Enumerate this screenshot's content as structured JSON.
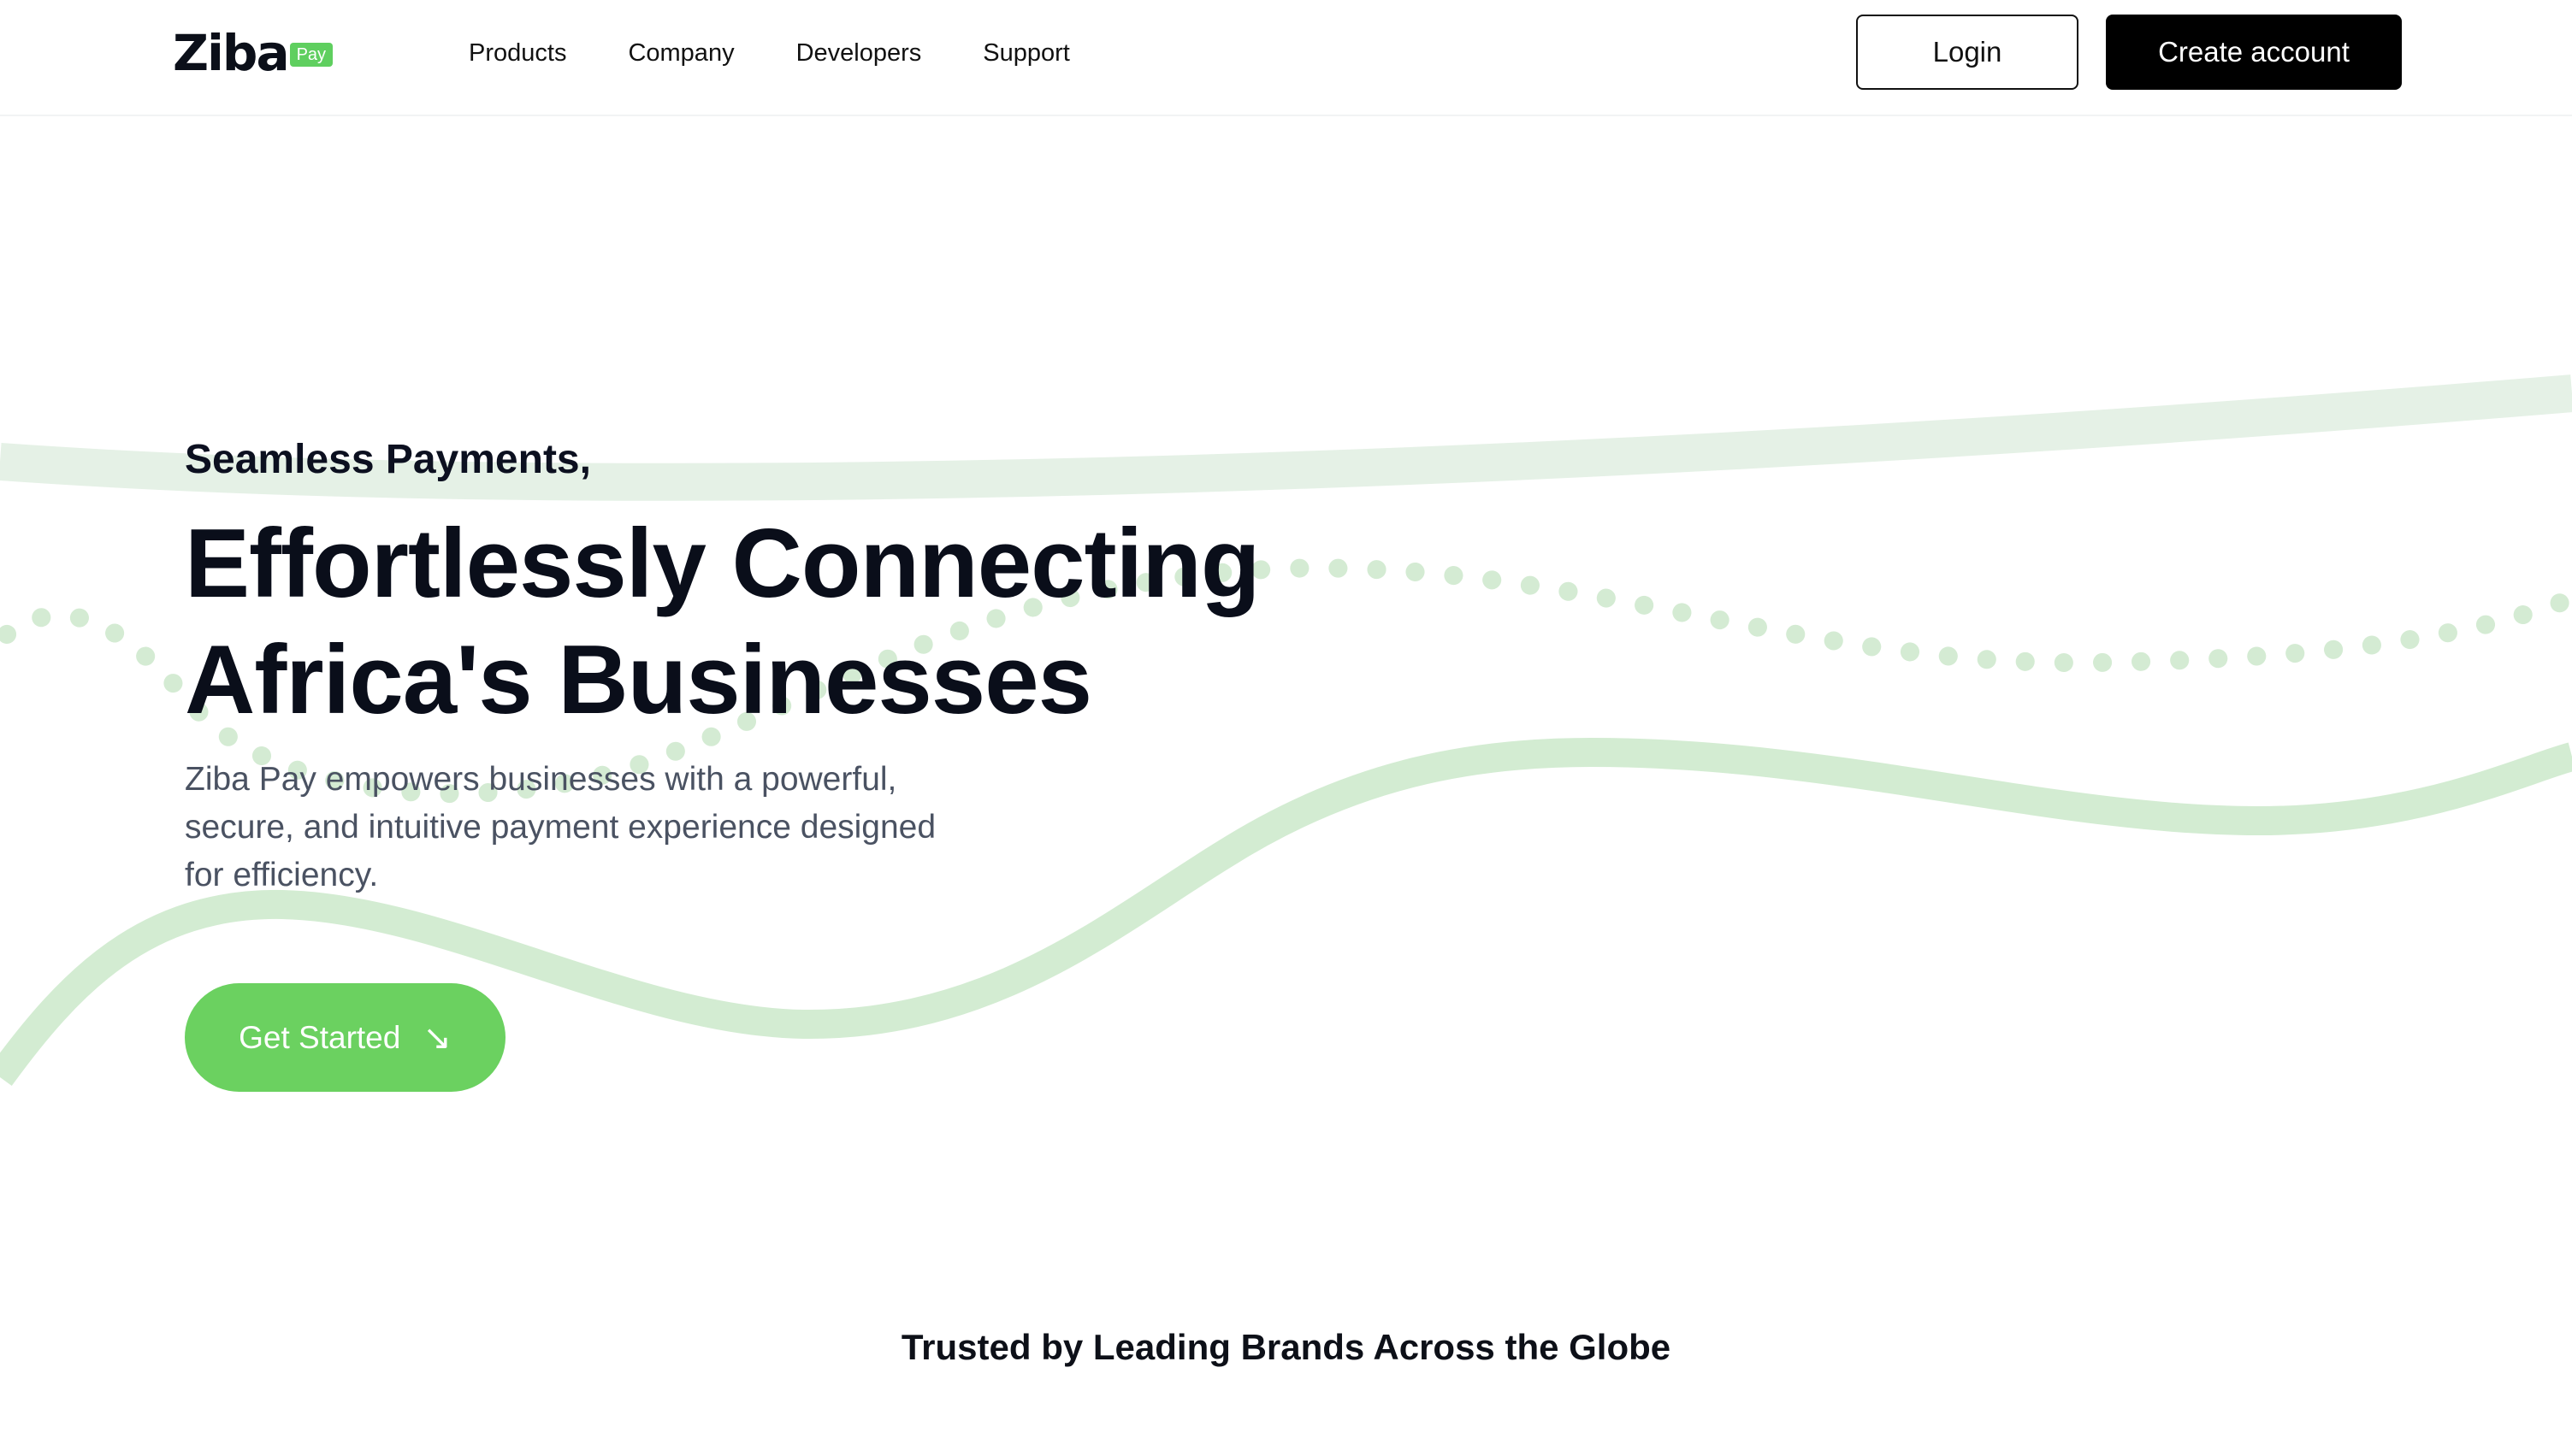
{
  "header": {
    "logo_text": "Ziba",
    "logo_badge": "Pay",
    "nav": [
      {
        "label": "Products"
      },
      {
        "label": "Company"
      },
      {
        "label": "Developers"
      },
      {
        "label": "Support"
      }
    ],
    "login_label": "Login",
    "create_account_label": "Create account"
  },
  "hero": {
    "eyebrow": "Seamless Payments,",
    "headline": "Effortlessly Connecting Africa's Businesses",
    "subtext": "Ziba Pay empowers businesses with a powerful, secure, and intuitive payment experience designed for efficiency.",
    "cta_label": "Get Started",
    "cta_icon": "arrow-down-right-icon"
  },
  "trusted_heading": "Trusted by Leading Brands Across the Globe",
  "colors": {
    "brand_green": "#6bd160",
    "wave_light": "#e5f1e6",
    "wave_mid": "#d3ecd2",
    "dots": "#d4ebd3",
    "text_dark": "#0a0e1a",
    "text_muted": "#4a5262"
  }
}
